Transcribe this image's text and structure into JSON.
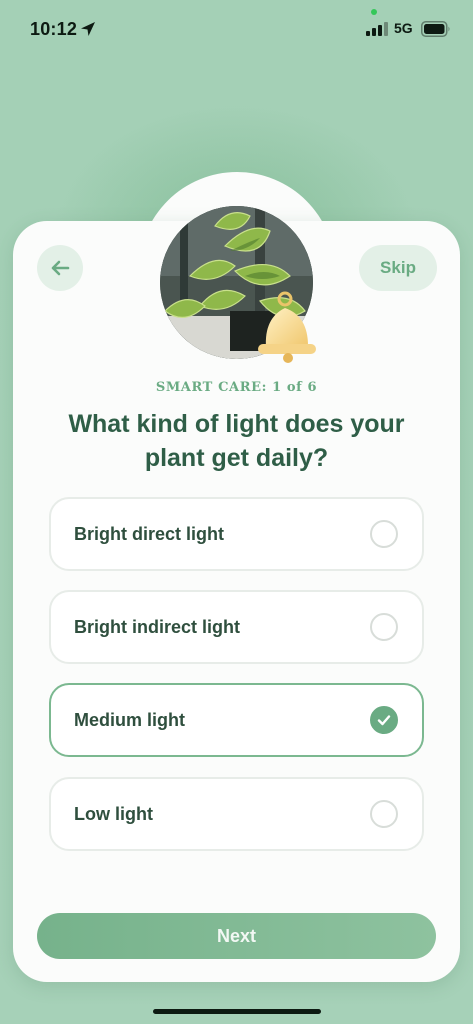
{
  "status_bar": {
    "time": "10:12",
    "network": "5G"
  },
  "header": {
    "back_icon": "arrow-left-icon",
    "skip_label": "Skip"
  },
  "hero": {
    "image": "pothos-plant-photo",
    "badge_icon": "bell-icon"
  },
  "quiz": {
    "step_label": "SMART CARE: 1 of 6",
    "question": "What kind of light does your plant get daily?",
    "options": [
      {
        "label": "Bright direct light",
        "selected": false
      },
      {
        "label": "Bright indirect light",
        "selected": false
      },
      {
        "label": "Medium light",
        "selected": true
      },
      {
        "label": "Low light",
        "selected": false
      }
    ]
  },
  "footer": {
    "next_label": "Next"
  },
  "colors": {
    "background": "#a6d1b7",
    "accent": "#6aab83",
    "heading": "#2f5e47",
    "card": "#fbfcfb"
  }
}
